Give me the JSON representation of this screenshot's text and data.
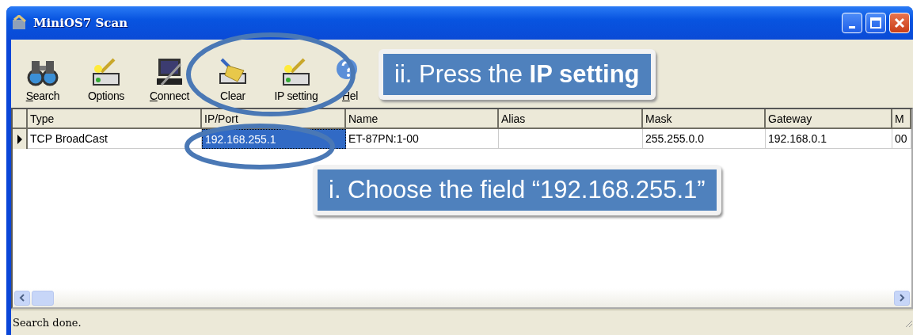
{
  "window": {
    "title": "MiniOS7 Scan"
  },
  "toolbar": [
    {
      "label": "Search",
      "underline_first": true
    },
    {
      "label": "Options",
      "underline_first": false
    },
    {
      "label": "Connect",
      "underline_first": true
    },
    {
      "label": "Clear",
      "underline_first": false
    },
    {
      "label": "IP setting",
      "underline_first": false
    },
    {
      "label": "Hel",
      "underline_first": true
    }
  ],
  "table": {
    "columns": [
      "Type",
      "IP/Port",
      "Name",
      "Alias",
      "Mask",
      "Gateway",
      "M"
    ],
    "rows": [
      {
        "current": true,
        "cells": [
          {
            "text": "TCP BroadCast",
            "selected": false
          },
          {
            "text": "192.168.255.1",
            "selected": true
          },
          {
            "text": "ET-87PN:1-00",
            "selected": false
          },
          {
            "text": "",
            "selected": false
          },
          {
            "text": "255.255.0.0",
            "selected": false
          },
          {
            "text": "192.168.0.1",
            "selected": false
          },
          {
            "text": "00",
            "selected": false
          }
        ]
      }
    ]
  },
  "status_bar": "Search done.",
  "callouts": [
    {
      "text": "ii. Press the **IP setting**"
    },
    {
      "text": "i. Choose the field “192.168.255.1”"
    }
  ]
}
